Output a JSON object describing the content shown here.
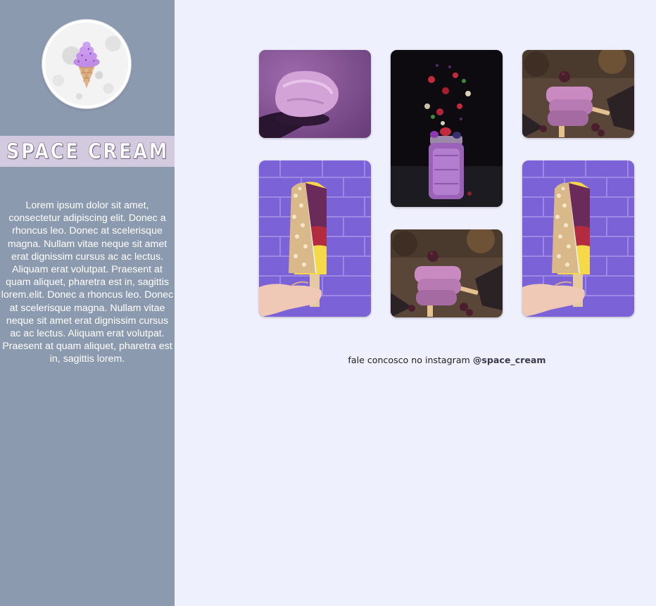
{
  "brand": {
    "title": "SPACE CREAM",
    "logo_icon": "ice-cream-cone-icon"
  },
  "sidebar": {
    "about": "Lorem ipsum dolor sit amet,\nconsectetur adipiscing elit. Donec a\nrhoncus leo. Donec at scelerisque\nmagna. Nullam vitae neque sit amet\nerat dignissim cursus ac ac lectus.\nAliquam erat volutpat. Praesent at\nquam aliquet, pharetra est in, sagittis\nlorem.elit. Donec a rhoncus leo. Donec\nat scelerisque magna. Nullam vitae\nneque sit amet erat dignissim cursus\nac ac lectus. Aliquam erat volutpat.\nPraesent at quam aliquet, pharetra est\nin, sagittis lorem."
  },
  "gallery": {
    "photos": [
      {
        "subject": "purple ice cream scoop on spoon"
      },
      {
        "subject": "berry smoothie jar with flying fruit"
      },
      {
        "subject": "stacked berry popsicles"
      },
      {
        "subject": "nut-coated popsicle held against purple brick wall"
      },
      {
        "subject": "stacked berry popsicles"
      },
      {
        "subject": "nut-coated popsicle held against purple brick wall"
      }
    ]
  },
  "footer": {
    "text": "fale concosco no instagram ",
    "handle": "@space_cream"
  },
  "colors": {
    "sidebar_bg": "#8c9ab0",
    "brand_band": "#d3cadf",
    "page_bg": "#eff0fe",
    "accent_purple": "#8e6bd0"
  }
}
